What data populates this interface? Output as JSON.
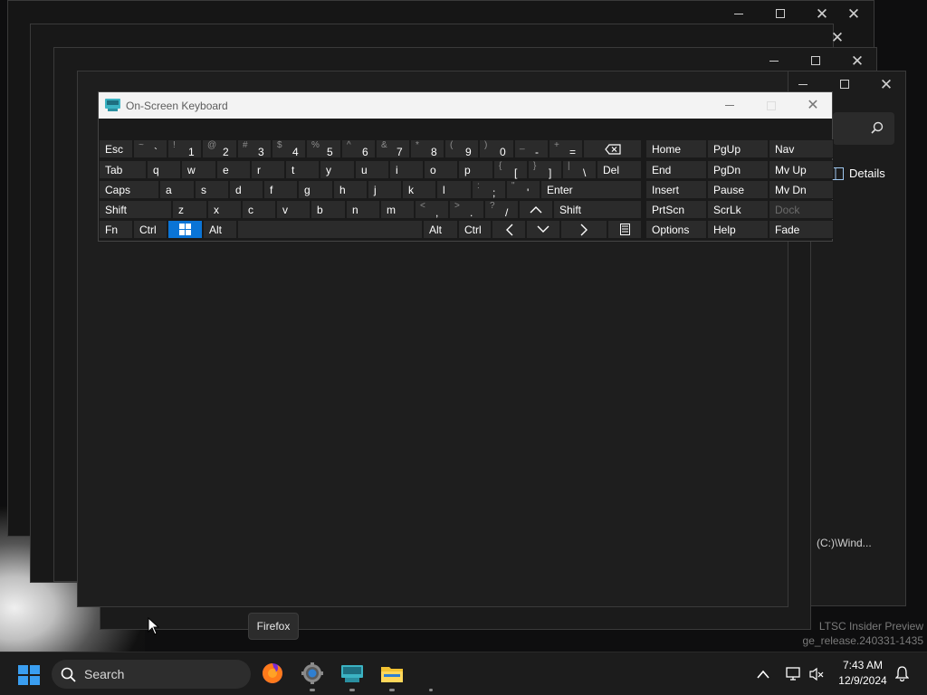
{
  "osk": {
    "title": "On-Screen Keyboard",
    "rows": [
      [
        {
          "label": "Esc"
        },
        {
          "shift": "~",
          "main": "`"
        },
        {
          "shift": "!",
          "main": "1"
        },
        {
          "shift": "@",
          "main": "2"
        },
        {
          "shift": "#",
          "main": "3"
        },
        {
          "shift": "$",
          "main": "4"
        },
        {
          "shift": "%",
          "main": "5"
        },
        {
          "shift": "^",
          "main": "6"
        },
        {
          "shift": "&",
          "main": "7"
        },
        {
          "shift": "*",
          "main": "8"
        },
        {
          "shift": "(",
          "main": "9"
        },
        {
          "shift": ")",
          "main": "0"
        },
        {
          "shift": "_",
          "main": "-"
        },
        {
          "shift": "+",
          "main": "="
        },
        {
          "icon": "backspace-icon"
        }
      ],
      [
        {
          "label": "Tab"
        },
        {
          "label": "q"
        },
        {
          "label": "w"
        },
        {
          "label": "e"
        },
        {
          "label": "r"
        },
        {
          "label": "t"
        },
        {
          "label": "y"
        },
        {
          "label": "u"
        },
        {
          "label": "i"
        },
        {
          "label": "o"
        },
        {
          "label": "p"
        },
        {
          "shift": "{",
          "main": "["
        },
        {
          "shift": "}",
          "main": "]"
        },
        {
          "shift": "|",
          "main": "\\"
        },
        {
          "label": "Del"
        }
      ],
      [
        {
          "label": "Caps"
        },
        {
          "label": "a"
        },
        {
          "label": "s"
        },
        {
          "label": "d"
        },
        {
          "label": "f"
        },
        {
          "label": "g"
        },
        {
          "label": "h"
        },
        {
          "label": "j"
        },
        {
          "label": "k"
        },
        {
          "label": "l"
        },
        {
          "shift": ":",
          "main": ";"
        },
        {
          "shift": "\"",
          "main": "'"
        },
        {
          "label": "Enter"
        }
      ],
      [
        {
          "label": "Shift"
        },
        {
          "label": "z"
        },
        {
          "label": "x"
        },
        {
          "label": "c"
        },
        {
          "label": "v"
        },
        {
          "label": "b"
        },
        {
          "label": "n"
        },
        {
          "label": "m"
        },
        {
          "shift": "<",
          "main": ","
        },
        {
          "shift": ">",
          "main": "."
        },
        {
          "shift": "?",
          "main": "/"
        },
        {
          "icon": "arrow-up-icon"
        },
        {
          "label": "Shift"
        }
      ],
      [
        {
          "label": "Fn"
        },
        {
          "label": "Ctrl"
        },
        {
          "icon": "windows-logo-icon",
          "active": true
        },
        {
          "label": "Alt"
        },
        {
          "label": ""
        },
        {
          "label": "Alt"
        },
        {
          "label": "Ctrl"
        },
        {
          "icon": "arrow-left-icon"
        },
        {
          "icon": "arrow-down-icon"
        },
        {
          "icon": "arrow-right-icon"
        },
        {
          "icon": "menu-key-icon"
        }
      ]
    ],
    "side_keys": [
      [
        "Home",
        "PgUp",
        "Nav"
      ],
      [
        "End",
        "PgDn",
        "Mv Up"
      ],
      [
        "Insert",
        "Pause",
        "Mv Dn"
      ],
      [
        "PrtScn",
        "ScrLk",
        "Dock"
      ],
      [
        "Options",
        "Help",
        "Fade"
      ]
    ],
    "dock_disabled": true
  },
  "background_window": {
    "details_label": "Details",
    "path_text": "(C:)\\Wind..."
  },
  "watermark": {
    "line1": "LTSC Insider Preview",
    "line2": "ge_release.240331-1435"
  },
  "tooltip": {
    "text": "Firefox"
  },
  "taskbar": {
    "search_label": "Search",
    "apps": [
      "firefox-icon",
      "settings-icon",
      "on-screen-keyboard-icon",
      "file-explorer-icon"
    ],
    "time": "7:43 AM",
    "date": "12/9/2024"
  },
  "colors": {
    "accent": "#0a74d6",
    "key_bg": "#2b2b2b",
    "osk_bg": "#1a1a1a",
    "titlebar_bg": "#f3f3f3"
  }
}
